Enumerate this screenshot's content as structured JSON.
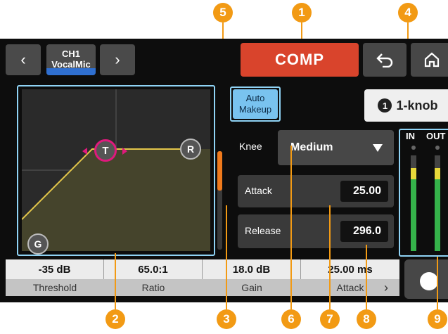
{
  "header": {
    "prev_icon": "chevron-left",
    "next_icon": "chevron-right",
    "channel_line1": "CH1",
    "channel_line2": "VocalMic",
    "title": "COMP",
    "back_icon": "undo-arrow",
    "home_icon": "home",
    "one_knob_number": "1",
    "one_knob_label": "1-knob"
  },
  "graph": {
    "handles": {
      "threshold": "T",
      "release": "R",
      "gain": "G"
    }
  },
  "auto_makeup": {
    "line1": "Auto",
    "line2": "Makeup"
  },
  "knee": {
    "label": "Knee",
    "value": "Medium"
  },
  "params": {
    "attack": {
      "label": "Attack",
      "value": "25.00"
    },
    "release": {
      "label": "Release",
      "value": "296.0"
    }
  },
  "meters": {
    "in_label": "IN",
    "out_label": "OUT",
    "in_level": 0.75,
    "out_level": 0.75
  },
  "bottom": [
    {
      "value": "-35 dB",
      "name": "Threshold"
    },
    {
      "value": "65.0:1",
      "name": "Ratio"
    },
    {
      "value": "18.0 dB",
      "name": "Gain"
    },
    {
      "value": "25.00 ms",
      "name": "Attack"
    }
  ],
  "bottom_next_icon": "chevron-right",
  "callouts": [
    "1",
    "2",
    "3",
    "4",
    "5",
    "6",
    "7",
    "8",
    "9"
  ],
  "colors": {
    "accent": "#f29a14",
    "comp": "#d9442c",
    "auto_makeup": "#79c3ef",
    "frame": "#8fd3f5",
    "curve": "#e3c64a"
  }
}
